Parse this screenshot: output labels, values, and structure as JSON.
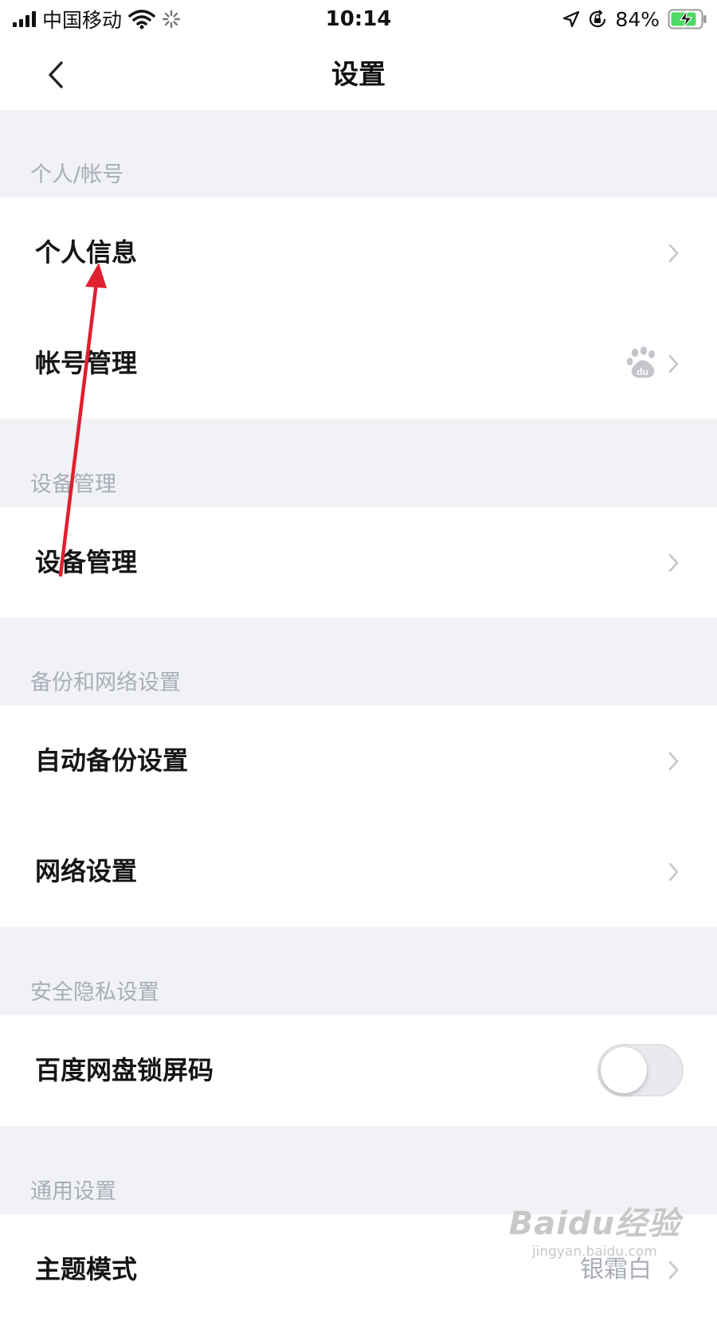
{
  "status_bar": {
    "carrier": "中国移动",
    "time": "10:14",
    "battery": "84%"
  },
  "nav": {
    "title": "设置"
  },
  "sections": [
    {
      "header": "个人/帐号",
      "items": [
        {
          "label": "个人信息"
        },
        {
          "label": "帐号管理",
          "icon": "baidu-paw-icon"
        }
      ]
    },
    {
      "header": "设备管理",
      "items": [
        {
          "label": "设备管理"
        }
      ]
    },
    {
      "header": "备份和网络设置",
      "items": [
        {
          "label": "自动备份设置"
        },
        {
          "label": "网络设置"
        }
      ]
    },
    {
      "header": "安全隐私设置",
      "items": [
        {
          "label": "百度网盘锁屏码",
          "toggle": false
        }
      ]
    },
    {
      "header": "通用设置",
      "items": [
        {
          "label": "主题模式",
          "value": "银霜白"
        }
      ]
    }
  ],
  "watermark": {
    "main": "Baidu经验",
    "sub": "jingyan.baidu.com"
  },
  "colors": {
    "annotation_arrow": "#e0202e",
    "section_bg": "#f1f2f6",
    "section_text": "#a9adb7"
  }
}
